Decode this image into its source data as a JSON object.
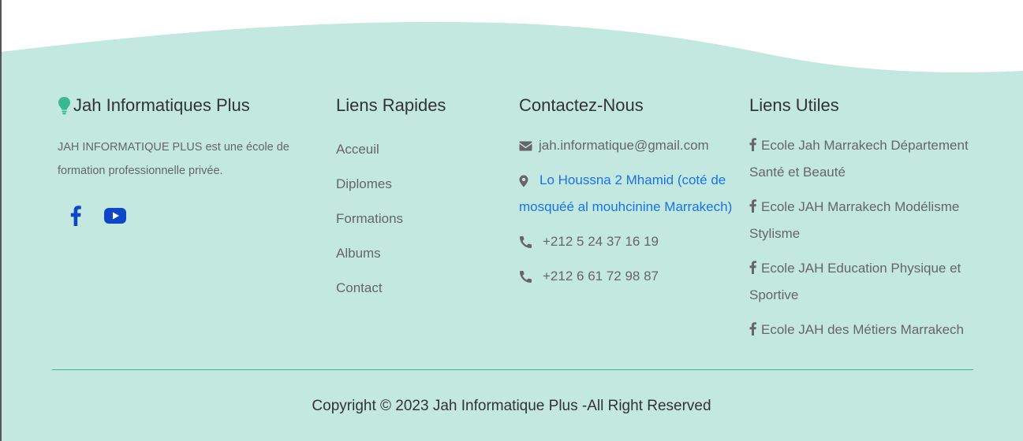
{
  "colors": {
    "footer_bg": "#c2e8e0",
    "accent": "#3bb890",
    "link_blue": "#1a73e8",
    "social_blue": "#0d47c8"
  },
  "brand": {
    "title": "Jah Informatiques Plus",
    "icon": "lightbulb-icon",
    "description": "JAH INFORMATIQUE PLUS est une école de formation professionnelle privée.",
    "social": [
      {
        "icon": "facebook-icon"
      },
      {
        "icon": "youtube-icon"
      }
    ]
  },
  "quick_links": {
    "heading": "Liens Rapides",
    "items": [
      "Acceuil",
      "Diplomes",
      "Formations",
      "Albums",
      "Contact"
    ]
  },
  "contact": {
    "heading": "Contactez-Nous",
    "email": "jah.informatique@gmail.com",
    "address": "Lo Houssna 2 Mhamid (coté de mosquéé al mouhcinine Marrakech)",
    "phone1": "+212 5 24 37 16 19",
    "phone2": "+212 6 61 72 98 87"
  },
  "useful_links": {
    "heading": "Liens Utiles",
    "items": [
      "Ecole Jah Marrakech Département Santé et Beauté",
      "Ecole JAH Marrakech Modélisme Stylisme",
      "Ecole JAH Education Physique et Sportive",
      "Ecole JAH des Métiers Marrakech"
    ]
  },
  "copyright": "Copyright © 2023 Jah Informatique Plus -All Right Reserved"
}
